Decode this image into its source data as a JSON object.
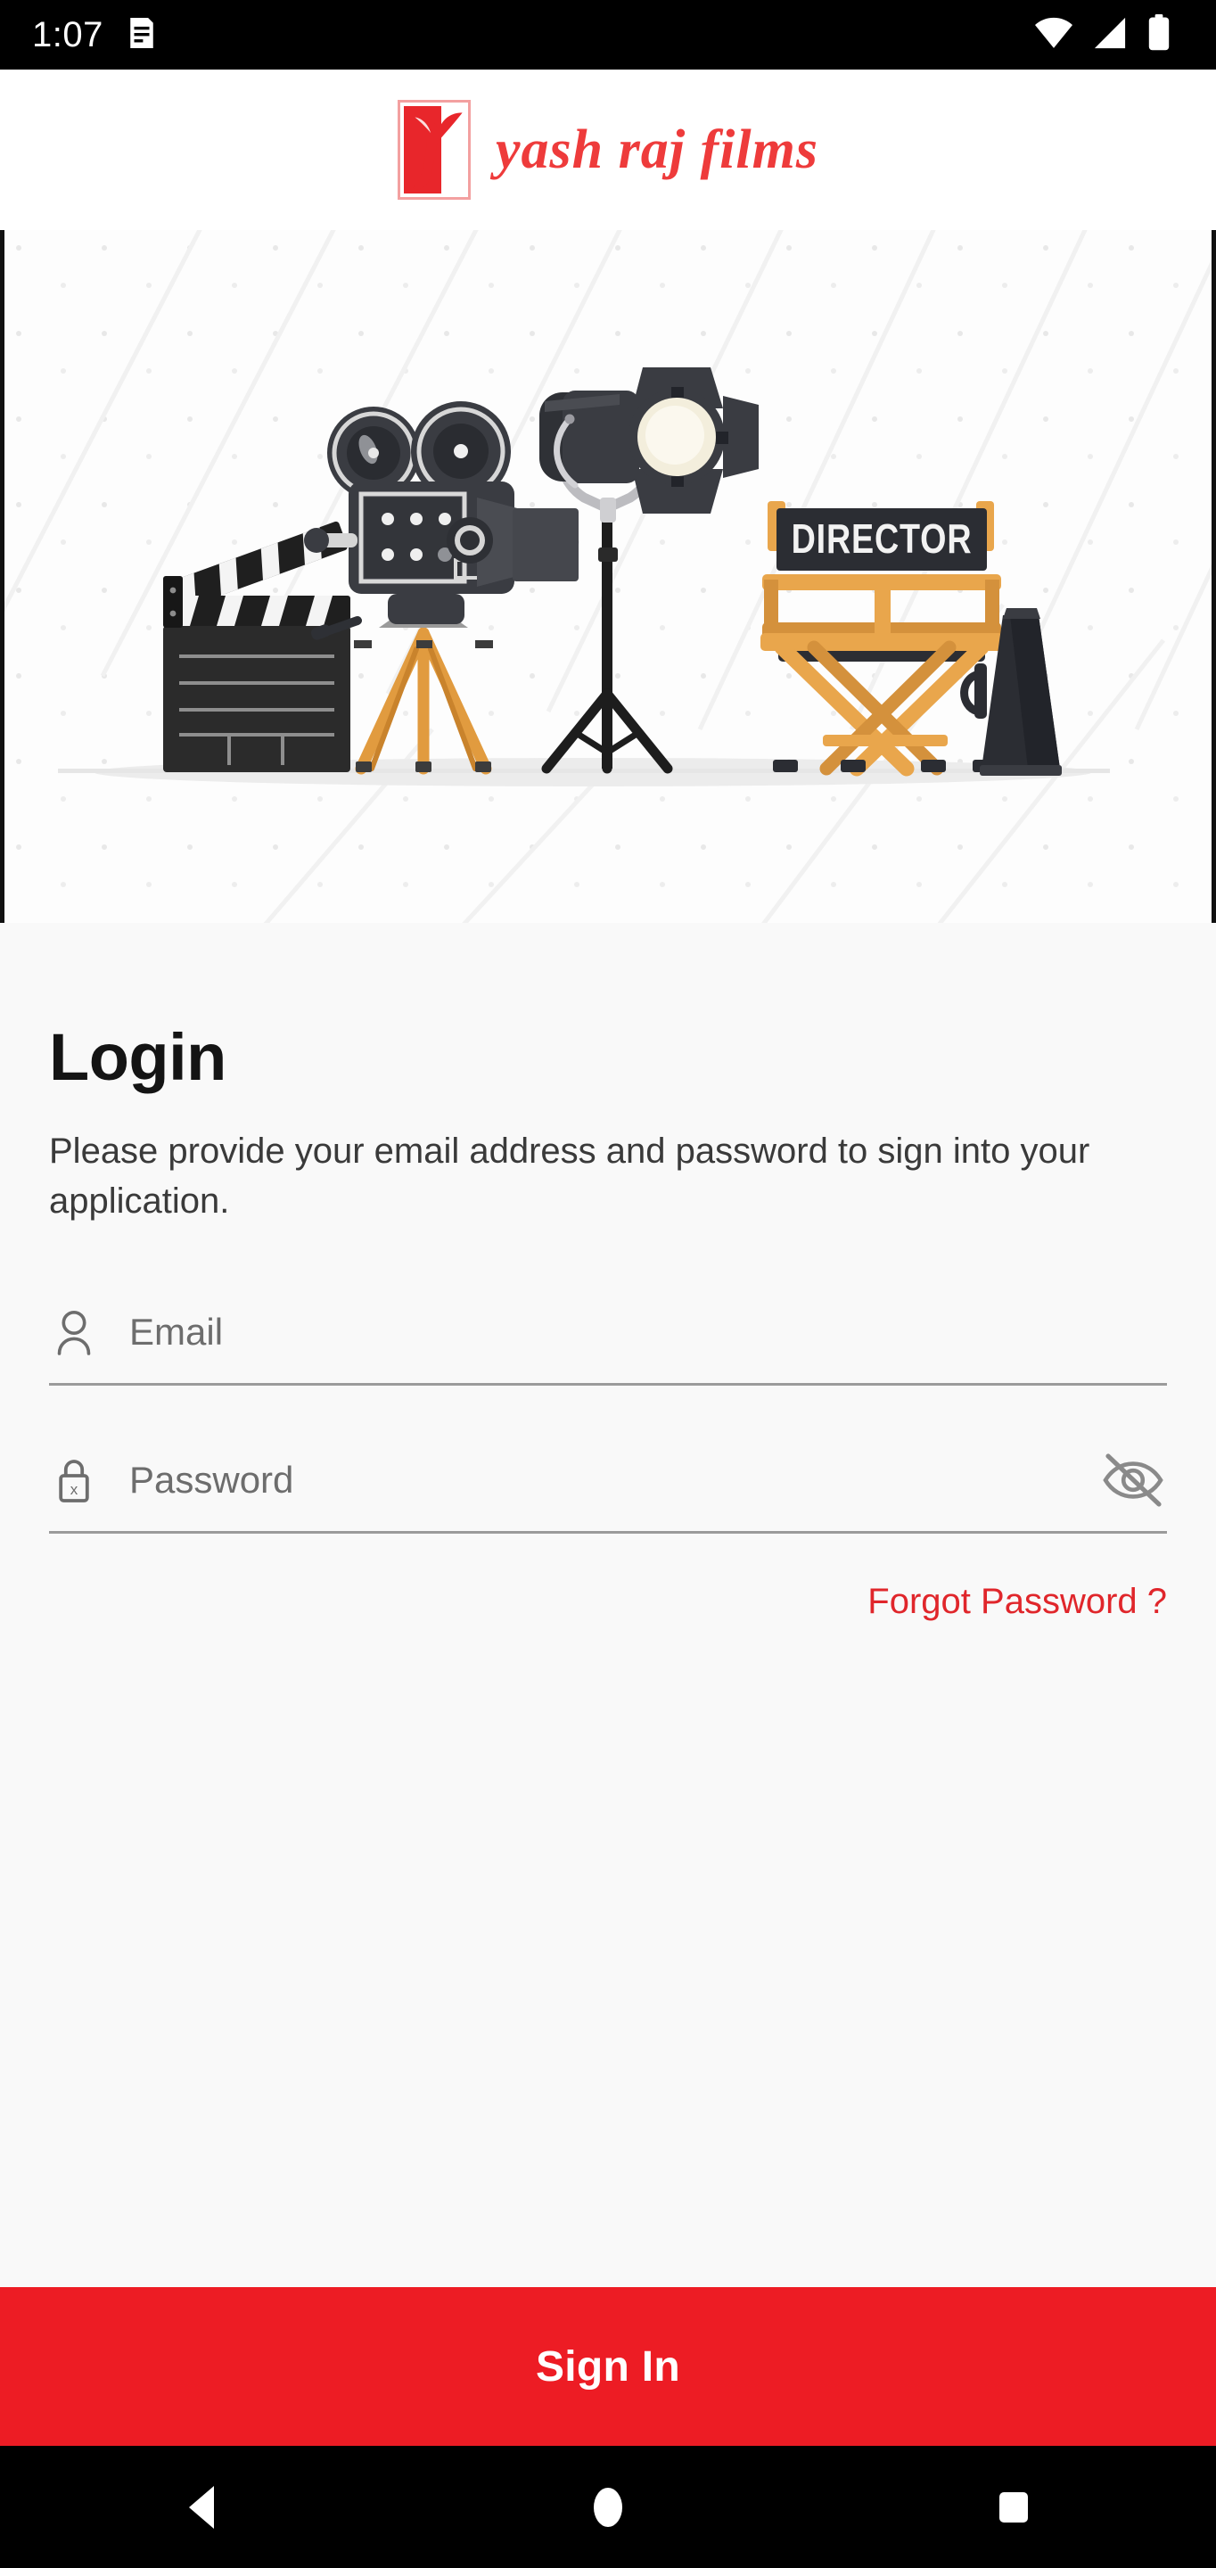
{
  "status_bar": {
    "time": "1:07",
    "notification_icon": "document-notification-icon",
    "wifi_icon": "wifi-icon",
    "signal_icon": "cellular-signal-icon",
    "battery_icon": "battery-full-icon"
  },
  "header": {
    "brand_name": "yash raj films",
    "logo_icon": "yash-raj-films-logo-icon",
    "brand_color": "#EE3B3B",
    "logo_box_color": "#E8262B"
  },
  "hero": {
    "alt": "film production equipment illustration",
    "director_chair_label": "DIRECTOR",
    "items": [
      "movie-camera-on-tripod",
      "studio-spotlight-on-stand",
      "clapperboard",
      "director-chair",
      "megaphone"
    ],
    "colors": {
      "background": "#fdfdfd",
      "equipment_dark": "#2f3136",
      "wood": "#E9A64C",
      "light_lens": "#F3EEDC"
    }
  },
  "login": {
    "title": "Login",
    "description": "Please provide your email address and password to sign into your application.",
    "email": {
      "placeholder": "Email",
      "value": "",
      "icon": "person-icon"
    },
    "password": {
      "placeholder": "Password",
      "value": "",
      "icon": "lock-icon",
      "toggle_icon": "eye-off-icon"
    },
    "forgot_password_label": "Forgot Password ?",
    "forgot_password_color": "#E0262B",
    "submit_label": "Sign In",
    "submit_color": "#ED1C24"
  },
  "nav_bar": {
    "back_icon": "back-triangle-icon",
    "home_icon": "home-circle-icon",
    "recents_icon": "recents-square-icon"
  }
}
